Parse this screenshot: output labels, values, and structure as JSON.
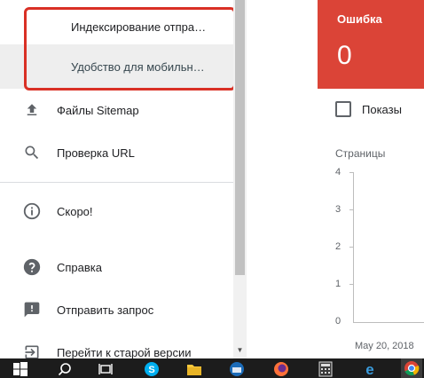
{
  "sidebar": {
    "sub_items": [
      {
        "label": "Индексирование отпра…"
      },
      {
        "label": "Удобство для мобильн…"
      }
    ],
    "items": [
      {
        "label": "Файлы Sitemap",
        "icon": "upload-icon"
      },
      {
        "label": "Проверка URL",
        "icon": "search-icon"
      },
      {
        "label": "Скоро!",
        "icon": "info-icon"
      },
      {
        "label": "Справка",
        "icon": "help-icon"
      },
      {
        "label": "Отправить запрос",
        "icon": "feedback-icon"
      },
      {
        "label": "Перейти к старой версии",
        "icon": "exit-icon"
      }
    ]
  },
  "error_card": {
    "title": "Ошибка",
    "value": "0",
    "color": "#db4437"
  },
  "impressions": {
    "label": "Показы",
    "checked": false
  },
  "chart_data": {
    "type": "line",
    "ylabel": "Страницы",
    "ylim": [
      0,
      4
    ],
    "yticks": [
      "4",
      "3",
      "2",
      "1",
      "0"
    ],
    "categories": [
      "May 20, 2018"
    ],
    "series": []
  },
  "taskbar": {
    "icons": [
      "windows-start-icon",
      "search-icon",
      "task-view-icon",
      "skype-icon",
      "file-explorer-icon",
      "thunderbird-icon",
      "firefox-icon",
      "calculator-icon",
      "edge-icon",
      "chrome-icon"
    ]
  }
}
